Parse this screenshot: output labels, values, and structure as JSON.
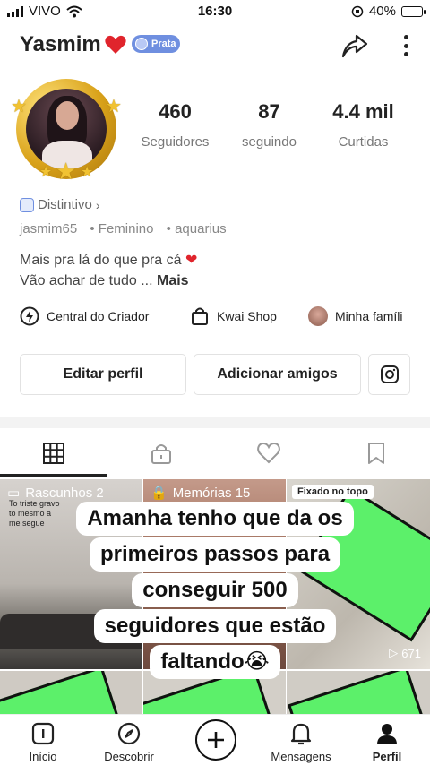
{
  "status_bar": {
    "carrier": "VIVO",
    "time": "16:30",
    "battery": "40%",
    "battery_level": 0.4
  },
  "header": {
    "username": "Yasmim",
    "badge": "Prata"
  },
  "stats": [
    {
      "value": "460",
      "label": "Seguidores"
    },
    {
      "value": "87",
      "label": "seguindo"
    },
    {
      "value": "4.4 mil",
      "label": "Curtidas"
    }
  ],
  "profile": {
    "distintivo": "Distintivo",
    "handle": "jasmim65",
    "gender": "• Feminino",
    "sign": "• aquarius",
    "bio_line1": "Mais pra lá do que pra cá",
    "bio_line2": "Vão achar de tudo ...",
    "bio_more": "Mais"
  },
  "links": {
    "creator": "Central do Criador",
    "shop": "Kwai Shop",
    "family": "Minha famíli"
  },
  "buttons": {
    "edit": "Editar perfil",
    "add_friends": "Adicionar amigos"
  },
  "grid": {
    "drafts": "Rascunhos 2",
    "memories": "Memórias 15",
    "pinned": "Fixado no topo",
    "plays": "671",
    "note": "To triste gravo to mesmo a me segue"
  },
  "caption": {
    "line1": "Amanha tenho que da os",
    "line2": "primeiros passos para",
    "line3": "conseguir 500",
    "line4": "seguidores que estão",
    "line5": "faltando😭"
  },
  "nav": {
    "home": "Início",
    "discover": "Descobrir",
    "messages": "Mensagens",
    "profile": "Perfil"
  },
  "colors": {
    "accent": "#6f8fe0",
    "gold": "#d9a21a",
    "green_card": "#5cf06a"
  }
}
